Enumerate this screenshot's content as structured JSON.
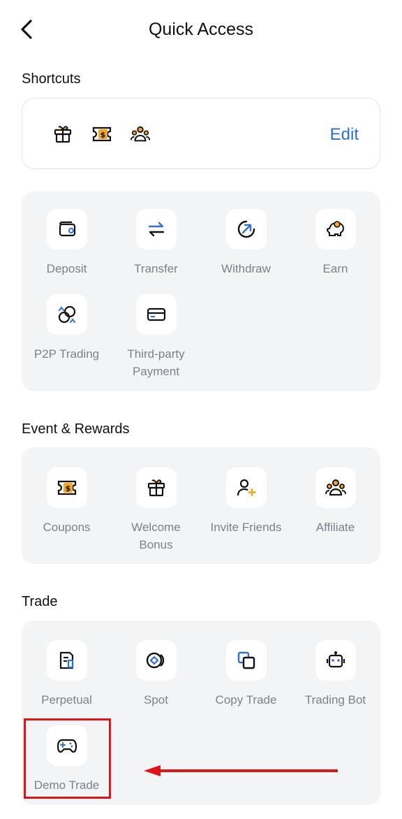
{
  "header": {
    "title": "Quick Access",
    "back_icon": "chevron-left-icon"
  },
  "shortcuts": {
    "title": "Shortcuts",
    "edit_label": "Edit",
    "icons": [
      "gift-icon",
      "coupon-icon",
      "affiliate-icon"
    ]
  },
  "wallet": {
    "items": [
      {
        "label": "Deposit",
        "icon": "wallet-icon"
      },
      {
        "label": "Transfer",
        "icon": "transfer-icon"
      },
      {
        "label": "Withdraw",
        "icon": "withdraw-icon"
      },
      {
        "label": "Earn",
        "icon": "piggy-bank-icon"
      },
      {
        "label": "P2P Trading",
        "icon": "p2p-icon"
      },
      {
        "label": "Third-party Payment",
        "icon": "card-icon"
      }
    ]
  },
  "events": {
    "title": "Event & Rewards",
    "items": [
      {
        "label": "Coupons",
        "icon": "coupon-icon"
      },
      {
        "label": "Welcome Bonus",
        "icon": "gift-icon"
      },
      {
        "label": "Invite Friends",
        "icon": "invite-user-icon"
      },
      {
        "label": "Affiliate",
        "icon": "affiliate-icon"
      }
    ]
  },
  "trade": {
    "title": "Trade",
    "items": [
      {
        "label": "Perpetual",
        "icon": "document-icon"
      },
      {
        "label": "Spot",
        "icon": "spot-icon"
      },
      {
        "label": "Copy Trade",
        "icon": "copy-icon"
      },
      {
        "label": "Trading Bot",
        "icon": "robot-icon"
      },
      {
        "label": "Demo Trade",
        "icon": "gamepad-icon"
      }
    ]
  },
  "annotation": {
    "highlight_color": "#e01515",
    "arrow_color": "#e01515"
  },
  "colors": {
    "accent": "#2f6fd6",
    "orange": "#f5a623",
    "icon_dark": "#111111"
  }
}
